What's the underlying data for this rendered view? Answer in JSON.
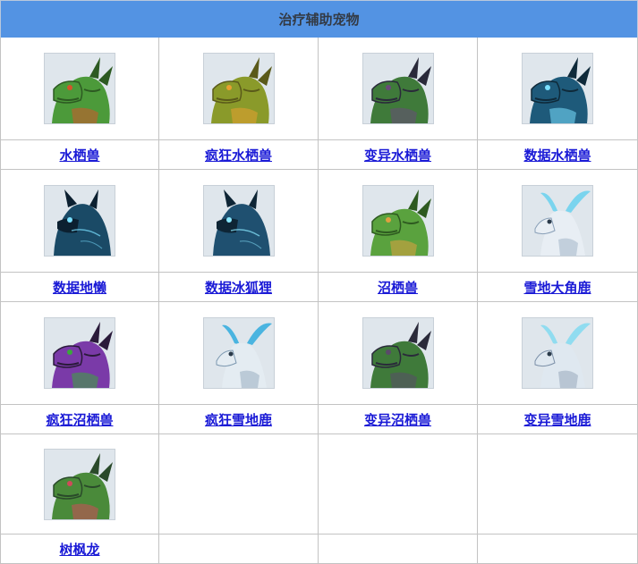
{
  "title": "治疗辅助宠物",
  "pets": [
    {
      "name": "水栖兽",
      "icon": "green-dragon-portrait",
      "colors": {
        "main": "#4c9a3a",
        "dark": "#2d5a22",
        "accent": "#d4552b",
        "bg": "#dfe6ec"
      }
    },
    {
      "name": "疯狂水栖兽",
      "icon": "olive-dragon-portrait",
      "colors": {
        "main": "#8a9a2a",
        "dark": "#5a5a1a",
        "accent": "#e8a030",
        "bg": "#dfe6ec"
      }
    },
    {
      "name": "变异水栖兽",
      "icon": "dark-green-dragon-portrait",
      "colors": {
        "main": "#3f7a3a",
        "dark": "#2a2a3a",
        "accent": "#6a4a7a",
        "bg": "#dfe6ec"
      }
    },
    {
      "name": "数据水栖兽",
      "icon": "cyber-dragon-portrait",
      "colors": {
        "main": "#1e5a7a",
        "dark": "#0f2a3a",
        "accent": "#7ae0ff",
        "bg": "#dfe6ec"
      }
    },
    {
      "name": "数据地懒",
      "icon": "cyber-sloth-portrait",
      "colors": {
        "main": "#1a4a66",
        "dark": "#0c2030",
        "accent": "#7ae0ff",
        "bg": "#dfe6ec"
      }
    },
    {
      "name": "数据冰狐狸",
      "icon": "cyber-fox-portrait",
      "colors": {
        "main": "#1f5070",
        "dark": "#0e2535",
        "accent": "#8ae8ff",
        "bg": "#dfe6ec"
      }
    },
    {
      "name": "沼栖兽",
      "icon": "swamp-dragon-portrait",
      "colors": {
        "main": "#5aa23e",
        "dark": "#2e5a20",
        "accent": "#e0a040",
        "bg": "#dfe6ec"
      }
    },
    {
      "name": "雪地大角鹿",
      "icon": "snow-deer-portrait",
      "colors": {
        "main": "#e8eef4",
        "dark": "#8aa0b8",
        "accent": "#7ad4ee",
        "bg": "#dfe6ec"
      }
    },
    {
      "name": "疯狂沼栖兽",
      "icon": "purple-dragon-portrait",
      "colors": {
        "main": "#7a3aa8",
        "dark": "#2a1a3a",
        "accent": "#3aa83a",
        "bg": "#dfe6ec"
      }
    },
    {
      "name": "疯狂雪地鹿",
      "icon": "frenzy-snow-deer-portrait",
      "colors": {
        "main": "#e4ecf2",
        "dark": "#7c98b0",
        "accent": "#4ab4e0",
        "bg": "#dfe6ec"
      }
    },
    {
      "name": "变异沼栖兽",
      "icon": "mutant-swamp-dragon-portrait",
      "colors": {
        "main": "#3f7a3a",
        "dark": "#2a2a3a",
        "accent": "#5a4a6a",
        "bg": "#dfe6ec"
      }
    },
    {
      "name": "变异雪地鹿",
      "icon": "mutant-snow-deer-portrait",
      "colors": {
        "main": "#dfe8f0",
        "dark": "#7c90a8",
        "accent": "#90dcf0",
        "bg": "#dfe6ec"
      }
    },
    {
      "name": "树枫龙",
      "icon": "maple-dragon-portrait",
      "colors": {
        "main": "#4a8a3a",
        "dark": "#2a4a2a",
        "accent": "#d04a5a",
        "bg": "#dfe6ec"
      }
    }
  ]
}
